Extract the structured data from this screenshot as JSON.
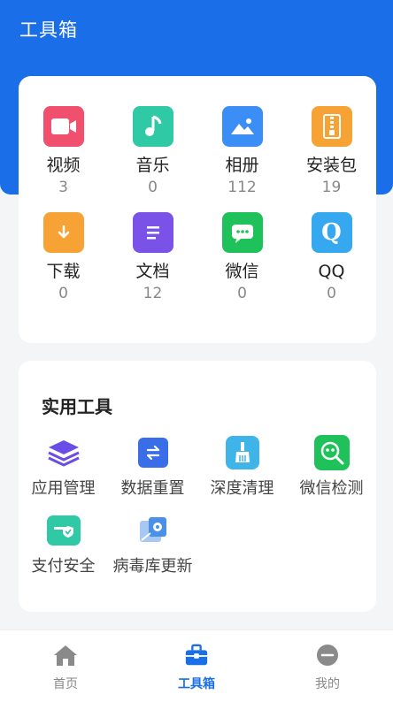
{
  "header": {
    "title": "工具箱"
  },
  "files": [
    {
      "label": "视频",
      "count": "3",
      "icon": "video-icon",
      "color": "#f0506e"
    },
    {
      "label": "音乐",
      "count": "0",
      "icon": "music-icon",
      "color": "#2fc9a5"
    },
    {
      "label": "相册",
      "count": "112",
      "icon": "photo-icon",
      "color": "#3a8ef6"
    },
    {
      "label": "安装包",
      "count": "19",
      "icon": "package-icon",
      "color": "#f7a234"
    },
    {
      "label": "下载",
      "count": "0",
      "icon": "download-icon",
      "color": "#f7a234"
    },
    {
      "label": "文档",
      "count": "12",
      "icon": "document-icon",
      "color": "#7b52e8"
    },
    {
      "label": "微信",
      "count": "0",
      "icon": "wechat-icon",
      "color": "#1fc15a"
    },
    {
      "label": "QQ",
      "count": "0",
      "icon": "qq-icon",
      "color": "#35a8f0"
    }
  ],
  "tools": {
    "title": "实用工具",
    "items": [
      {
        "label": "应用管理",
        "icon": "layers-icon",
        "color": "#6a4de6"
      },
      {
        "label": "数据重置",
        "icon": "swap-icon",
        "color": "#3a6ee8"
      },
      {
        "label": "深度清理",
        "icon": "broom-icon",
        "color": "#3fb4e8"
      },
      {
        "label": "微信检测",
        "icon": "wechat-scan-icon",
        "color": "#1fc15a"
      },
      {
        "label": "支付安全",
        "icon": "payment-shield-icon",
        "color": "#2fc9a5"
      },
      {
        "label": "病毒库更新",
        "icon": "virus-db-icon",
        "color": "#4a90e8"
      }
    ]
  },
  "tabbar": {
    "items": [
      {
        "label": "首页",
        "icon": "home-icon",
        "active": false
      },
      {
        "label": "工具箱",
        "icon": "toolbox-icon",
        "active": true
      },
      {
        "label": "我的",
        "icon": "profile-icon",
        "active": false
      }
    ]
  },
  "colors": {
    "primary": "#1a6fe8",
    "background": "#f4f5f7"
  }
}
